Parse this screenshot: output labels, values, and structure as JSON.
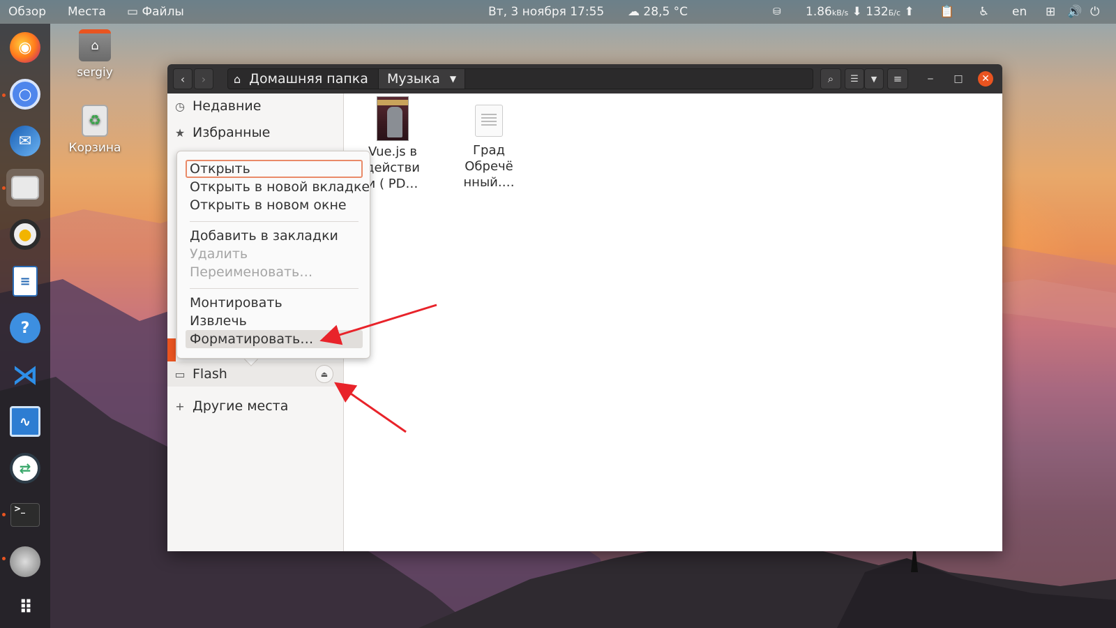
{
  "topbar": {
    "activities": "Обзор",
    "places": "Места",
    "files_app": "Файлы",
    "datetime": "Вт, 3 ноября  17:55",
    "weather": "28,5 °C",
    "net_down_value": "1.86",
    "net_down_unit": "kB/s",
    "net_up_value": "132",
    "net_up_unit": "Б/с",
    "lang": "en"
  },
  "dock": {
    "apps": [
      "firefox-icon",
      "chromium-icon",
      "thunderbird-icon",
      "files-icon",
      "rhythmbox-icon",
      "writer-icon",
      "help-icon",
      "vscode-icon",
      "system-monitor-icon",
      "remmina-icon",
      "terminal-icon",
      "disks-icon",
      "app-grid-icon"
    ]
  },
  "desktop": {
    "home_label": "sergiy",
    "trash_label": "Корзина"
  },
  "window": {
    "path_home": "Домашняя папка",
    "path_current": "Музыка"
  },
  "sidebar": {
    "recent": "Недавние",
    "starred": "Избранные",
    "flash": "Flash",
    "other_places": "Другие места"
  },
  "context_menu": {
    "open": "Открыть",
    "open_new_tab": "Открыть в новой вкладке",
    "open_new_window": "Открыть в новом окне",
    "add_bookmark": "Добавить в закладки",
    "remove": "Удалить",
    "rename": "Переименовать…",
    "mount": "Монтировать",
    "eject": "Извлечь",
    "format": "Форматировать…"
  },
  "files": [
    {
      "name_line1": "Vue.js в",
      "name_line2": "действи",
      "name_line3": "и ( PD…",
      "type": "pdf-book"
    },
    {
      "name_line1": "Град",
      "name_line2": "Обречё",
      "name_line3": "нный.…",
      "type": "text-doc"
    }
  ],
  "colors": {
    "accent": "#e95420",
    "headerbar": "#333233",
    "arrow": "#e8232a"
  }
}
